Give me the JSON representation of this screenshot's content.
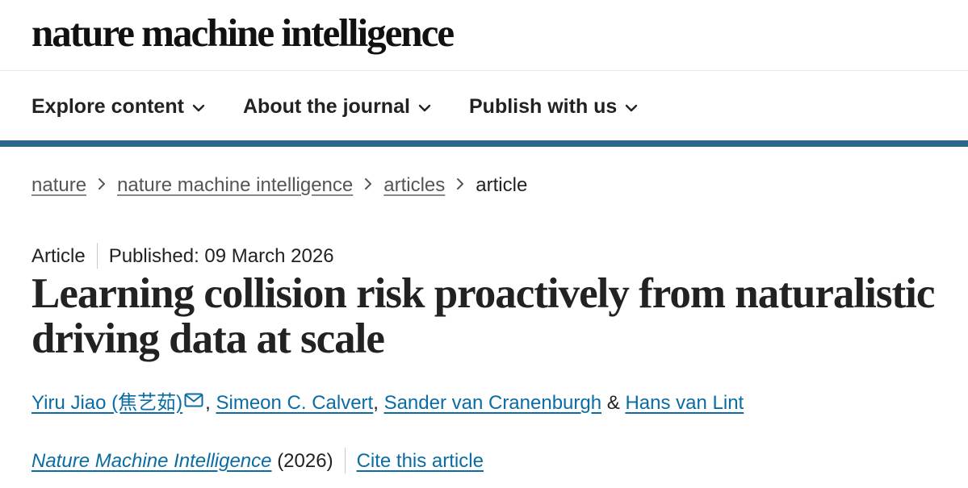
{
  "header": {
    "logo_text": "nature machine intelligence"
  },
  "nav": {
    "items": [
      {
        "label": "Explore content",
        "icon": "chevron-down-icon"
      },
      {
        "label": "About the journal",
        "icon": "chevron-down-icon"
      },
      {
        "label": "Publish with us",
        "icon": "chevron-down-icon"
      }
    ]
  },
  "breadcrumb": {
    "items": [
      "nature",
      "nature machine intelligence",
      "articles"
    ],
    "current": "article"
  },
  "article": {
    "type": "Article",
    "published": "Published: 09 March 2026",
    "title": "Learning collision risk proactively from naturalistic driving data at scale",
    "authors": [
      {
        "name": "Yiru Jiao  (焦艺茹)",
        "icon": "mail-icon"
      },
      {
        "name": "Simeon C. Calvert"
      },
      {
        "name": "Sander van Cranenburgh"
      },
      {
        "name": "Hans van Lint"
      }
    ],
    "author_separators": [
      ",",
      ",",
      "&"
    ],
    "journal": "Nature Machine Intelligence",
    "year": "(2026)",
    "cite_label": "Cite this article"
  },
  "colors": {
    "accent_bar": "#29678c",
    "link": "#0a6ca5",
    "text": "#222222"
  }
}
